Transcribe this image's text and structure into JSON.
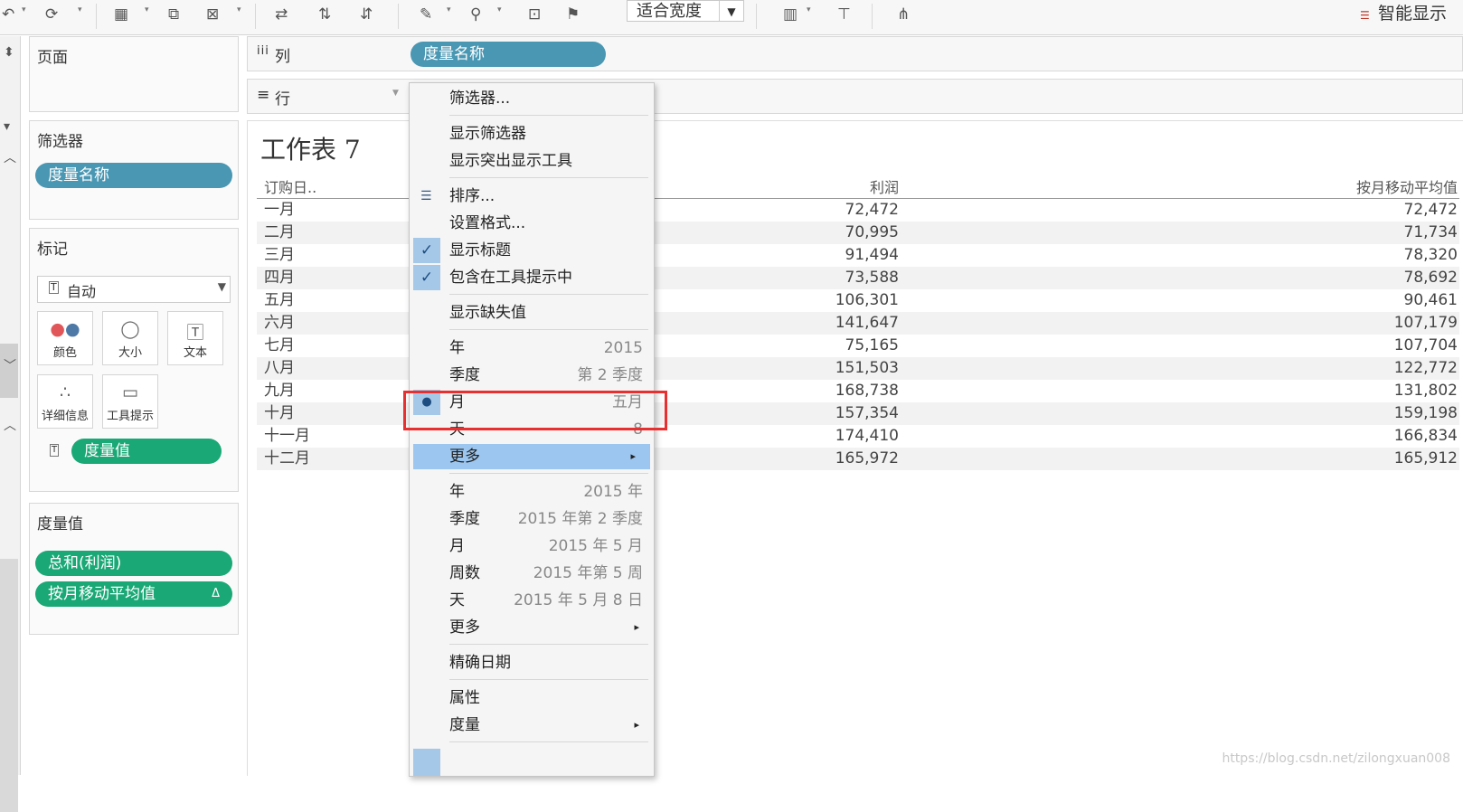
{
  "toolbar": {
    "fit_label": "适合宽度",
    "smart_show": "智能显示"
  },
  "left_panel": {
    "pages_title": "页面",
    "filters_title": "筛选器",
    "filters_pill": "度量名称",
    "marks_title": "标记",
    "marks_type": "自动",
    "mark_buttons": [
      "颜色",
      "大小",
      "文本",
      "详细信息",
      "工具提示"
    ],
    "marks_pill": "度量值",
    "measure_values_title": "度量值",
    "measure_pills": [
      "总和(利润)",
      "按月移动平均值"
    ],
    "delta_glyph": "Δ"
  },
  "shelves": {
    "columns_icon": "iii",
    "columns_label": "列",
    "columns_pill": "度量名称",
    "rows_icon": "≡",
    "rows_label": "行"
  },
  "view": {
    "sheet_title": "工作表 7",
    "table": {
      "headers": [
        "订购日..",
        "利润",
        "按月移动平均值"
      ],
      "rows": [
        [
          "一月",
          "72,472",
          "72,472"
        ],
        [
          "二月",
          "70,995",
          "71,734"
        ],
        [
          "三月",
          "91,494",
          "78,320"
        ],
        [
          "四月",
          "73,588",
          "78,692"
        ],
        [
          "五月",
          "106,301",
          "90,461"
        ],
        [
          "六月",
          "141,647",
          "107,179"
        ],
        [
          "七月",
          "75,165",
          "107,704"
        ],
        [
          "八月",
          "151,503",
          "122,772"
        ],
        [
          "九月",
          "168,738",
          "131,802"
        ],
        [
          "十月",
          "157,354",
          "159,198"
        ],
        [
          "十一月",
          "174,410",
          "166,834"
        ],
        [
          "十二月",
          "165,972",
          "165,912"
        ]
      ]
    }
  },
  "context_menu": {
    "filter": "筛选器...",
    "show_filter": "显示筛选器",
    "show_highlighter": "显示突出显示工具",
    "sort": "排序...",
    "format": "设置格式...",
    "show_header": "显示标题",
    "include_tooltip": "包含在工具提示中",
    "show_missing": "显示缺失值",
    "date_parts": [
      {
        "label": "年",
        "value": "2015"
      },
      {
        "label": "季度",
        "value": "第 2 季度"
      },
      {
        "label": "月",
        "value": "五月"
      },
      {
        "label": "天",
        "value": "8"
      }
    ],
    "more1": "更多",
    "date_values": [
      {
        "label": "年",
        "value": "2015 年"
      },
      {
        "label": "季度",
        "value": "2015 年第 2 季度"
      },
      {
        "label": "月",
        "value": "2015 年 5 月"
      },
      {
        "label": "周数",
        "value": "2015 年第 5 周"
      },
      {
        "label": "天",
        "value": "2015 年 5 月 8 日"
      }
    ],
    "more2": "更多",
    "exact_date": "精确日期",
    "attribute": "属性",
    "measure": "度量",
    "check_glyph": "✓",
    "bullet_glyph": "●",
    "submenu_glyph": "▸"
  },
  "watermark": "https://blog.csdn.net/zilongxuan008"
}
